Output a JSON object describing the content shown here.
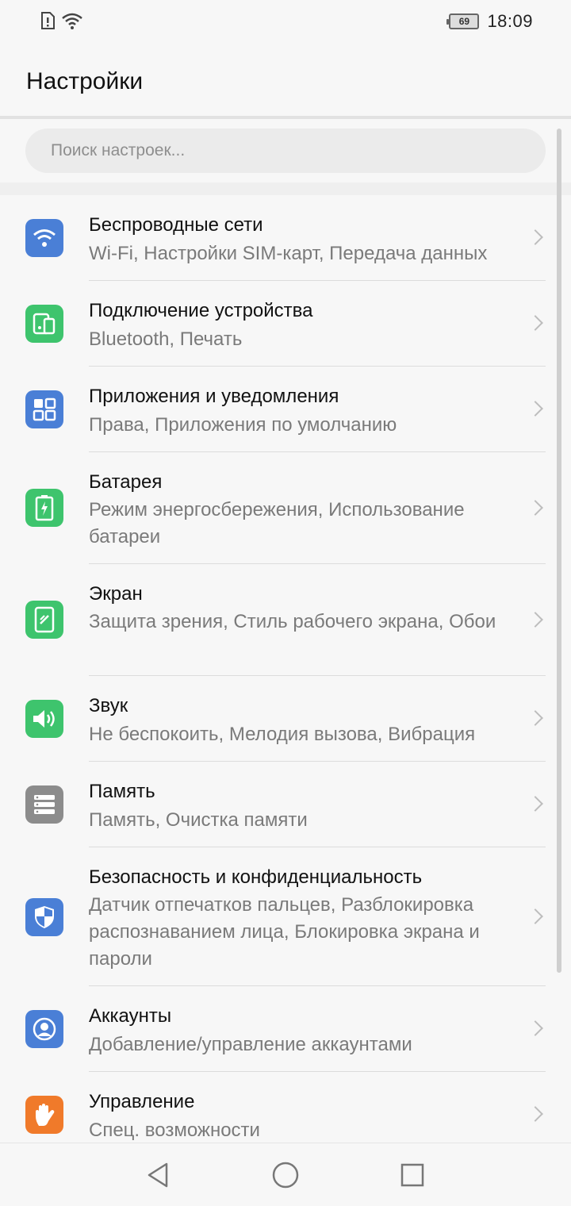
{
  "status_bar": {
    "battery_level": "69",
    "time": "18:09"
  },
  "header": {
    "title": "Настройки"
  },
  "search": {
    "placeholder": "Поиск настроек..."
  },
  "colors": {
    "blue": "#4a7fd6",
    "green": "#3ec46d",
    "gray": "#8c8c8c",
    "orange": "#f07a2a"
  },
  "settings": [
    {
      "title": "Беспроводные сети",
      "subtitle": "Wi-Fi, Настройки SIM-карт, Передача данных",
      "icon": "wifi-icon",
      "color": "#4a7fd6"
    },
    {
      "title": "Подключение устройства",
      "subtitle": "Bluetooth, Печать",
      "icon": "device-connection-icon",
      "color": "#3ec46d"
    },
    {
      "title": "Приложения и уведомления",
      "subtitle": "Права, Приложения по умолчанию",
      "icon": "apps-grid-icon",
      "color": "#4a7fd6"
    },
    {
      "title": "Батарея",
      "subtitle": "Режим энергосбережения, Использование батареи",
      "icon": "battery-icon",
      "color": "#3ec46d"
    },
    {
      "title": "Экран",
      "subtitle": "Защита зрения, Стиль рабочего экрана, Обои",
      "icon": "display-icon",
      "color": "#3ec46d"
    },
    {
      "title": "Звук",
      "subtitle": "Не беспокоить, Мелодия вызова, Вибрация",
      "icon": "speaker-icon",
      "color": "#3ec46d"
    },
    {
      "title": "Память",
      "subtitle": "Память, Очистка памяти",
      "icon": "storage-icon",
      "color": "#8c8c8c"
    },
    {
      "title": "Безопасность и конфиденциальность",
      "subtitle": "Датчик отпечатков пальцев, Разблокировка распознаванием лица, Блокировка экрана и пароли",
      "icon": "shield-icon",
      "color": "#4a7fd6"
    },
    {
      "title": "Аккаунты",
      "subtitle": "Добавление/управление аккаунтами",
      "icon": "account-icon",
      "color": "#4a7fd6"
    },
    {
      "title": "Управление",
      "subtitle": "Спец. возможности",
      "icon": "hand-icon",
      "color": "#f07a2a"
    }
  ],
  "nav": {
    "back": "back-icon",
    "home": "home-icon",
    "recents": "recents-icon"
  }
}
